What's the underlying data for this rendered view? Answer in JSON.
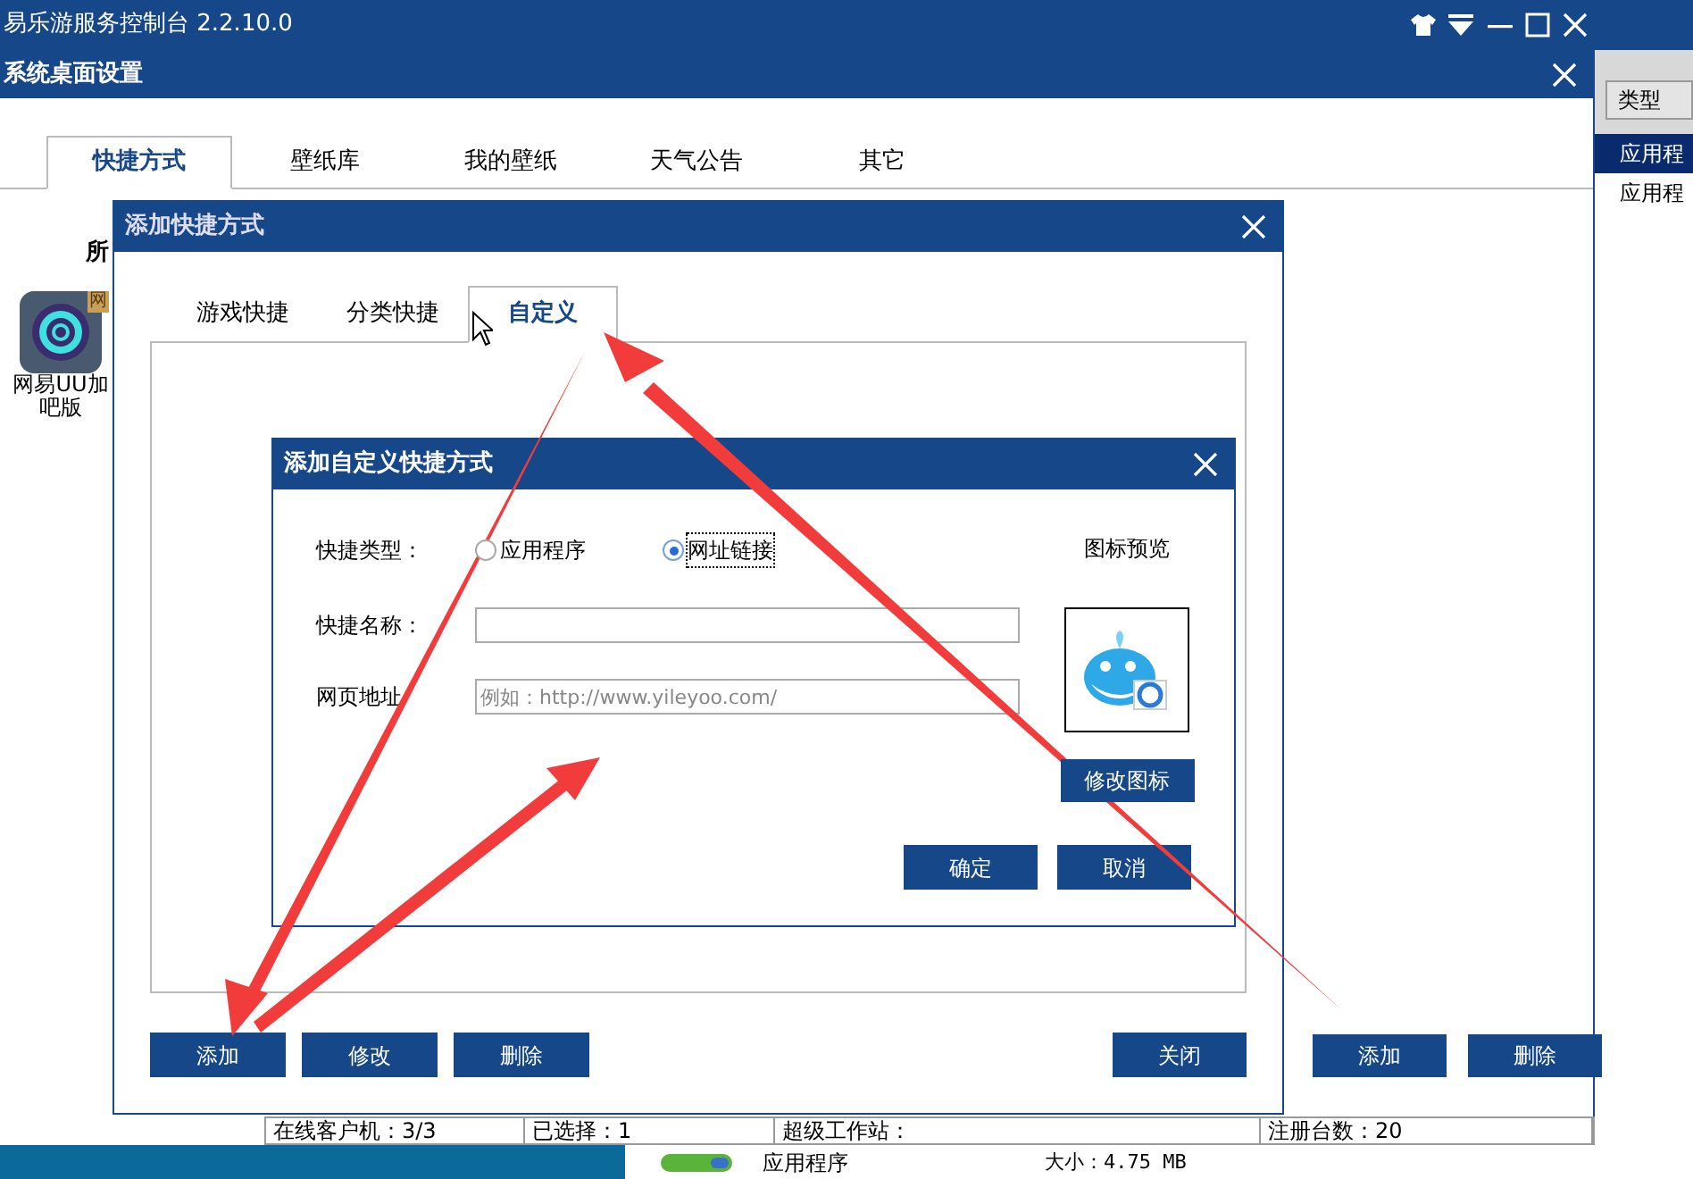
{
  "app": {
    "title": "易乐游服务控制台 2.2.10.0"
  },
  "side_list": {
    "header": "类型",
    "rows": [
      {
        "text": "应用程",
        "selected": true
      },
      {
        "text": "应用程",
        "selected": false
      }
    ]
  },
  "settings_window": {
    "title": "系统桌面设置",
    "tabs": [
      {
        "label": "快捷方式",
        "selected": true
      },
      {
        "label": "壁纸库",
        "selected": false
      },
      {
        "label": "我的壁纸",
        "selected": false
      },
      {
        "label": "天气公告",
        "selected": false
      },
      {
        "label": "其它",
        "selected": false
      }
    ],
    "section_label": "所",
    "app_item": {
      "badge": "网",
      "name_lines": [
        "网易UU加",
        "吧版"
      ]
    },
    "buttons": [
      "添加",
      "删除"
    ]
  },
  "status_bar": [
    "在线客户机：3/3",
    "已选择：1",
    "超级工作站：",
    "注册台数：20"
  ],
  "bottom_row": {
    "type": "应用程序",
    "size": "大小：4.75 MB"
  },
  "add_dialog": {
    "title": "添加快捷方式",
    "tabs": [
      {
        "label": "游戏快捷",
        "selected": false
      },
      {
        "label": "分类快捷",
        "selected": false
      },
      {
        "label": "自定义",
        "selected": true
      }
    ],
    "buttons": [
      "添加",
      "修改",
      "删除"
    ],
    "close_button": "关闭"
  },
  "custom_dialog": {
    "title": "添加自定义快捷方式",
    "type_label": "快捷类型：",
    "options": [
      {
        "label": "应用程序",
        "selected": false
      },
      {
        "label": "网址链接",
        "selected": true
      }
    ],
    "name_label": "快捷名称：",
    "url_label": "网页地址",
    "url_placeholder": "例如：http://www.yileyoo.com/",
    "preview_label": "图标预览",
    "change_icon_button": "修改图标",
    "ok_button": "确定",
    "cancel_button": "取消"
  }
}
